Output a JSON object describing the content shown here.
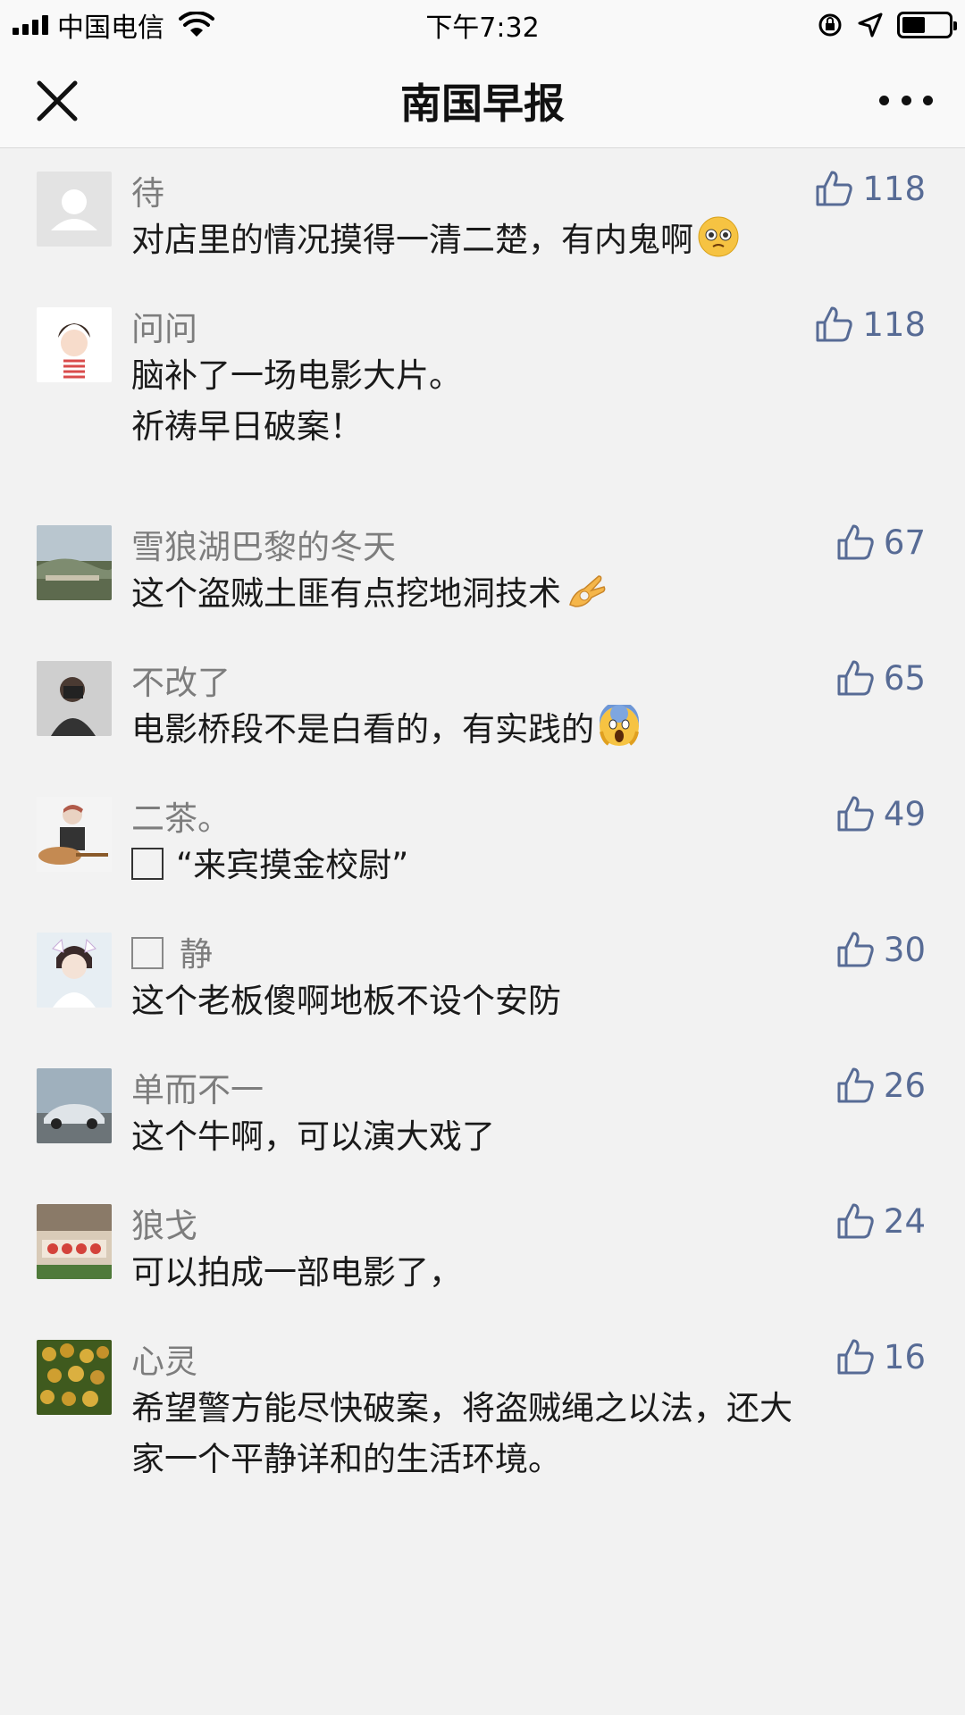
{
  "status_bar": {
    "carrier": "中国电信",
    "time": "下午7:32"
  },
  "nav": {
    "title": "南国早报"
  },
  "comments": [
    {
      "name": "待",
      "text": "对店里的情况摸得一清二楚，有内鬼啊",
      "likes": "118",
      "emoji": "pleading-face"
    },
    {
      "name": "问问",
      "text": "脑补了一场电影大片。\n祈祷早日破案！",
      "likes": "118"
    },
    {
      "name": "雪狼湖巴黎的冬天",
      "text": "这个盗贼土匪有点挖地洞技术",
      "likes": "67",
      "emoji": "ok-hand"
    },
    {
      "name": "不改了",
      "text": "电影桥段不是白看的，有实践的",
      "likes": "65",
      "emoji": "screaming-face"
    },
    {
      "name": "二茶。",
      "text": "“来宾摸金校尉”",
      "likes": "49",
      "text_prefix_box": true
    },
    {
      "name": "静",
      "text": "这个老板傻啊地板不设个安防",
      "likes": "30",
      "name_prefix_box": true
    },
    {
      "name": "单而不一",
      "text": "这个牛啊，可以演大戏了",
      "likes": "26"
    },
    {
      "name": "狼戈",
      "text": "可以拍成一部电影了，",
      "likes": "24"
    },
    {
      "name": "心灵",
      "text": "希望警方能尽快破案，将盗贼绳之以法，还大\n家一个平静详和的生活环境。",
      "likes": "16"
    }
  ],
  "colors": {
    "link_blue": "#576b95",
    "name_gray": "#7d7d7d",
    "background": "#f2f2f2"
  }
}
